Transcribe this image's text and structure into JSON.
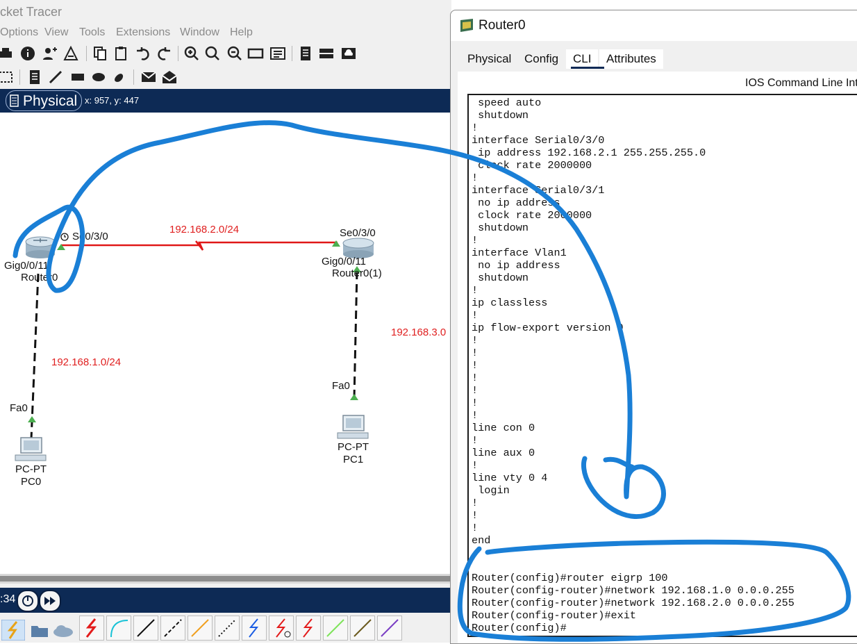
{
  "app": {
    "title_fragment": "cket Tracer"
  },
  "menu": [
    "Options",
    "View",
    "Tools",
    "Extensions",
    "Window",
    "Help"
  ],
  "workspace": {
    "mode": "Physical",
    "coords": "x: 957, y: 447"
  },
  "topology": {
    "devices": [
      {
        "id": "router0",
        "type": "Router0",
        "port_lan": "Gig0/0/11",
        "port_wan": "Se0/3/0"
      },
      {
        "id": "router1",
        "type": "Router0(1)",
        "port_lan": "Gig0/0/11",
        "port_wan": "Se0/3/0"
      },
      {
        "id": "pc0",
        "model": "PC-PT",
        "name": "PC0",
        "port": "Fa0"
      },
      {
        "id": "pc1",
        "model": "PC-PT",
        "name": "PC1",
        "port": "Fa0"
      }
    ],
    "networks": [
      "192.168.2.0/24",
      "192.168.1.0/24",
      "192.168.3.0"
    ]
  },
  "sim": {
    "time_fragment": ":34"
  },
  "dialog": {
    "title": "Router0",
    "tabs": [
      "Physical",
      "Config",
      "CLI",
      "Attributes"
    ],
    "active_tab": "CLI",
    "cli_header": "IOS Command Line Interface",
    "cli_lines": [
      " speed auto",
      " shutdown",
      "!",
      "interface Serial0/3/0",
      " ip address 192.168.2.1 255.255.255.0",
      " clock rate 2000000",
      "!",
      "interface Serial0/3/1",
      " no ip address",
      " clock rate 2000000",
      " shutdown",
      "!",
      "interface Vlan1",
      " no ip address",
      " shutdown",
      "!",
      "ip classless",
      "!",
      "ip flow-export version 9",
      "!",
      "!",
      "!",
      "!",
      "!",
      "!",
      "!",
      "line con 0",
      "!",
      "line aux 0",
      "!",
      "line vty 0 4",
      " login",
      "!",
      "!",
      "!",
      "end",
      "",
      "",
      "Router(config)#router eigrp 100",
      "Router(config-router)#network 192.168.1.0 0.0.0.255",
      "Router(config-router)#network 192.168.2.0 0.0.0.255",
      "Router(config-router)#exit",
      "Router(config)#"
    ]
  },
  "colors": {
    "accent_bar": "#0d2a55",
    "link_red": "#e02020",
    "ink_blue": "#1a7fd6",
    "port_green": "#4caf50"
  }
}
